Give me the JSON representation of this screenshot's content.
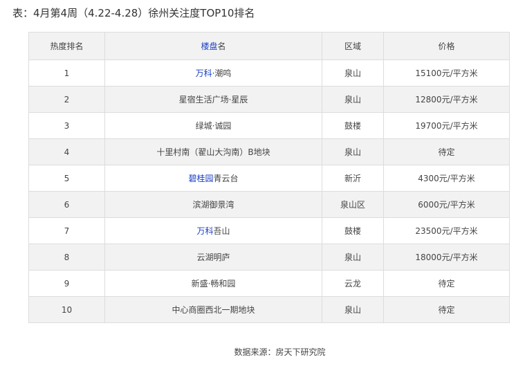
{
  "title": "表：4月第4周（4.22-4.28）徐州关注度TOP10排名",
  "table": {
    "headers": {
      "rank": "热度排名",
      "name_link": "楼盘",
      "name_suffix": "名",
      "district": "区域",
      "price": "价格"
    },
    "rows": [
      {
        "rank": "1",
        "name_link": "万科",
        "name_rest": "·潮鸣",
        "district": "泉山",
        "price": "15100元/平方米"
      },
      {
        "rank": "2",
        "name_link": "",
        "name_rest": "星宿生活广场·星辰",
        "district": "泉山",
        "price": "12800元/平方米"
      },
      {
        "rank": "3",
        "name_link": "",
        "name_rest": "绿城·诚园",
        "district": "鼓楼",
        "price": "19700元/平方米"
      },
      {
        "rank": "4",
        "name_link": "",
        "name_rest": "十里村南（翟山大沟南）B地块",
        "district": "泉山",
        "price": "待定"
      },
      {
        "rank": "5",
        "name_link": "碧桂园",
        "name_rest": "青云台",
        "district": "新沂",
        "price": "4300元/平方米"
      },
      {
        "rank": "6",
        "name_link": "",
        "name_rest": "滨湖御景湾",
        "district": "泉山区",
        "price": "6000元/平方米"
      },
      {
        "rank": "7",
        "name_link": "万科",
        "name_rest": "吾山",
        "district": "鼓楼",
        "price": "23500元/平方米"
      },
      {
        "rank": "8",
        "name_link": "",
        "name_rest": "云湖明庐",
        "district": "泉山",
        "price": "18000元/平方米"
      },
      {
        "rank": "9",
        "name_link": "",
        "name_rest": "新盛·畅和园",
        "district": "云龙",
        "price": "待定"
      },
      {
        "rank": "10",
        "name_link": "",
        "name_rest": "中心商圈西北一期地块",
        "district": "泉山",
        "price": "待定"
      }
    ]
  },
  "source": "数据来源：房天下研究院",
  "colors": {
    "link": "#1a3fc4",
    "header_bg": "#f2f2f2",
    "border": "#dcdcdc"
  }
}
